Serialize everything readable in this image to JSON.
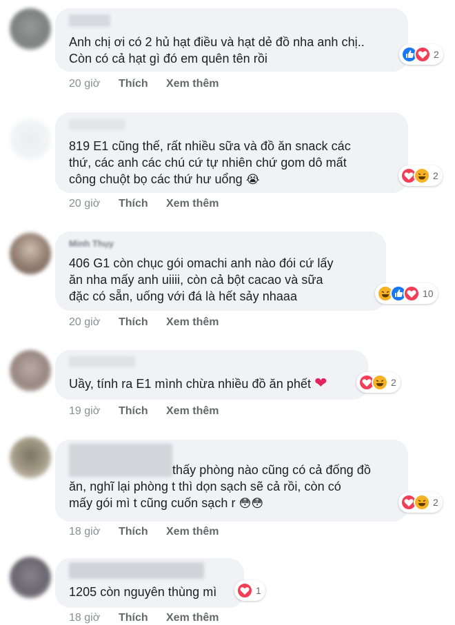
{
  "comments": [
    {
      "text_lines": [
        "Anh chị ơi có 2 hủ hạt điều và hạt dẻ đồ nha anh chị..",
        "Còn có cả hạt gì đó em quên tên rồi"
      ],
      "reactions": [
        "like",
        "love"
      ],
      "reaction_count": "2",
      "time": "20 giờ",
      "like_label": "Thích",
      "more_label": "Xem thêm"
    },
    {
      "text_lines": [
        "819 E1 cũng thế, rất nhiều sữa và đồ ăn snack các",
        "thứ, các anh các chú cứ tự nhiên chứ gom dô mất",
        "công chuột bọ các thứ hư uổng"
      ],
      "emoji": "😭",
      "reactions": [
        "love",
        "haha"
      ],
      "reaction_count": "2",
      "time": "20 giờ",
      "like_label": "Thích",
      "more_label": "Xem thêm"
    },
    {
      "name": "Minh Thụy",
      "text_lines": [
        "406 G1 còn chục gói omachi anh nào đói cứ lấy",
        "ăn nha mấy anh uiiii, còn cả bột cacao và sữa",
        "đặc có sẵn, uống với đá là hết sảy nhaaa"
      ],
      "reactions": [
        "haha",
        "like",
        "love"
      ],
      "reaction_count": "10",
      "time": "20 giờ",
      "like_label": "Thích",
      "more_label": "Xem thêm"
    },
    {
      "text_lines": [
        "Uầy, tính ra E1 mình chừa nhiều đồ ăn phết"
      ],
      "emoji": "❤",
      "reactions": [
        "love",
        "haha"
      ],
      "reaction_count": "2",
      "time": "19 giờ",
      "like_label": "Thích",
      "more_label": "Xem thêm"
    },
    {
      "text_lines": [
        "thấy phòng nào cũng có cả đống đồ",
        "ăn, nghĩ lại phòng t thì dọn sạch sẽ cả rồi, còn có",
        "mấy gói mì t cũng cuốn sạch r"
      ],
      "emoji": "😳😳",
      "reactions": [
        "love",
        "haha"
      ],
      "reaction_count": "2",
      "time": "18 giờ",
      "like_label": "Thích",
      "more_label": "Xem thêm"
    },
    {
      "text_lines": [
        "1205 còn nguyên thùng mì"
      ],
      "reactions": [
        "love"
      ],
      "reaction_count": "1",
      "time": "18 giờ",
      "like_label": "Thích",
      "more_label": "Xem thêm"
    }
  ],
  "colors": {
    "bubble": "#f0f2f5",
    "like": "#1877f2",
    "love": "#f33e58",
    "haha": "#f7b125",
    "meta": "#65676b"
  },
  "icons": {
    "like": "like-reaction-icon",
    "love": "love-reaction-icon",
    "haha": "haha-reaction-icon"
  }
}
